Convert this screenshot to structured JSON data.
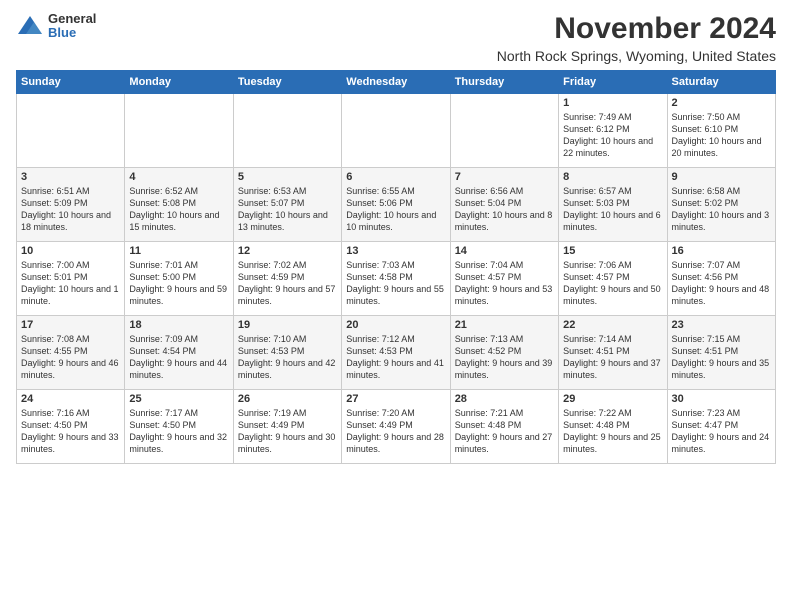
{
  "logo": {
    "general": "General",
    "blue": "Blue"
  },
  "title": "November 2024",
  "subtitle": "North Rock Springs, Wyoming, United States",
  "days_of_week": [
    "Sunday",
    "Monday",
    "Tuesday",
    "Wednesday",
    "Thursday",
    "Friday",
    "Saturday"
  ],
  "weeks": [
    [
      {
        "day": "",
        "content": ""
      },
      {
        "day": "",
        "content": ""
      },
      {
        "day": "",
        "content": ""
      },
      {
        "day": "",
        "content": ""
      },
      {
        "day": "",
        "content": ""
      },
      {
        "day": "1",
        "content": "Sunrise: 7:49 AM\nSunset: 6:12 PM\nDaylight: 10 hours and 22 minutes."
      },
      {
        "day": "2",
        "content": "Sunrise: 7:50 AM\nSunset: 6:10 PM\nDaylight: 10 hours and 20 minutes."
      }
    ],
    [
      {
        "day": "3",
        "content": "Sunrise: 6:51 AM\nSunset: 5:09 PM\nDaylight: 10 hours and 18 minutes."
      },
      {
        "day": "4",
        "content": "Sunrise: 6:52 AM\nSunset: 5:08 PM\nDaylight: 10 hours and 15 minutes."
      },
      {
        "day": "5",
        "content": "Sunrise: 6:53 AM\nSunset: 5:07 PM\nDaylight: 10 hours and 13 minutes."
      },
      {
        "day": "6",
        "content": "Sunrise: 6:55 AM\nSunset: 5:06 PM\nDaylight: 10 hours and 10 minutes."
      },
      {
        "day": "7",
        "content": "Sunrise: 6:56 AM\nSunset: 5:04 PM\nDaylight: 10 hours and 8 minutes."
      },
      {
        "day": "8",
        "content": "Sunrise: 6:57 AM\nSunset: 5:03 PM\nDaylight: 10 hours and 6 minutes."
      },
      {
        "day": "9",
        "content": "Sunrise: 6:58 AM\nSunset: 5:02 PM\nDaylight: 10 hours and 3 minutes."
      }
    ],
    [
      {
        "day": "10",
        "content": "Sunrise: 7:00 AM\nSunset: 5:01 PM\nDaylight: 10 hours and 1 minute."
      },
      {
        "day": "11",
        "content": "Sunrise: 7:01 AM\nSunset: 5:00 PM\nDaylight: 9 hours and 59 minutes."
      },
      {
        "day": "12",
        "content": "Sunrise: 7:02 AM\nSunset: 4:59 PM\nDaylight: 9 hours and 57 minutes."
      },
      {
        "day": "13",
        "content": "Sunrise: 7:03 AM\nSunset: 4:58 PM\nDaylight: 9 hours and 55 minutes."
      },
      {
        "day": "14",
        "content": "Sunrise: 7:04 AM\nSunset: 4:57 PM\nDaylight: 9 hours and 53 minutes."
      },
      {
        "day": "15",
        "content": "Sunrise: 7:06 AM\nSunset: 4:57 PM\nDaylight: 9 hours and 50 minutes."
      },
      {
        "day": "16",
        "content": "Sunrise: 7:07 AM\nSunset: 4:56 PM\nDaylight: 9 hours and 48 minutes."
      }
    ],
    [
      {
        "day": "17",
        "content": "Sunrise: 7:08 AM\nSunset: 4:55 PM\nDaylight: 9 hours and 46 minutes."
      },
      {
        "day": "18",
        "content": "Sunrise: 7:09 AM\nSunset: 4:54 PM\nDaylight: 9 hours and 44 minutes."
      },
      {
        "day": "19",
        "content": "Sunrise: 7:10 AM\nSunset: 4:53 PM\nDaylight: 9 hours and 42 minutes."
      },
      {
        "day": "20",
        "content": "Sunrise: 7:12 AM\nSunset: 4:53 PM\nDaylight: 9 hours and 41 minutes."
      },
      {
        "day": "21",
        "content": "Sunrise: 7:13 AM\nSunset: 4:52 PM\nDaylight: 9 hours and 39 minutes."
      },
      {
        "day": "22",
        "content": "Sunrise: 7:14 AM\nSunset: 4:51 PM\nDaylight: 9 hours and 37 minutes."
      },
      {
        "day": "23",
        "content": "Sunrise: 7:15 AM\nSunset: 4:51 PM\nDaylight: 9 hours and 35 minutes."
      }
    ],
    [
      {
        "day": "24",
        "content": "Sunrise: 7:16 AM\nSunset: 4:50 PM\nDaylight: 9 hours and 33 minutes."
      },
      {
        "day": "25",
        "content": "Sunrise: 7:17 AM\nSunset: 4:50 PM\nDaylight: 9 hours and 32 minutes."
      },
      {
        "day": "26",
        "content": "Sunrise: 7:19 AM\nSunset: 4:49 PM\nDaylight: 9 hours and 30 minutes."
      },
      {
        "day": "27",
        "content": "Sunrise: 7:20 AM\nSunset: 4:49 PM\nDaylight: 9 hours and 28 minutes."
      },
      {
        "day": "28",
        "content": "Sunrise: 7:21 AM\nSunset: 4:48 PM\nDaylight: 9 hours and 27 minutes."
      },
      {
        "day": "29",
        "content": "Sunrise: 7:22 AM\nSunset: 4:48 PM\nDaylight: 9 hours and 25 minutes."
      },
      {
        "day": "30",
        "content": "Sunrise: 7:23 AM\nSunset: 4:47 PM\nDaylight: 9 hours and 24 minutes."
      }
    ]
  ]
}
